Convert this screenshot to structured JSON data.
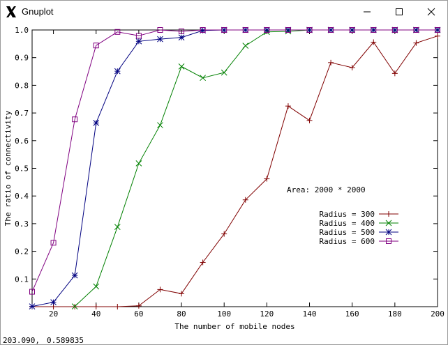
{
  "window": {
    "title": "Gnuplot",
    "app_icon": "gnuplot-x-icon",
    "controls": [
      "minimize-icon",
      "maximize-icon",
      "close-icon"
    ]
  },
  "status": {
    "x": "203.090,",
    "y": "0.589835"
  },
  "chart_data": {
    "type": "line",
    "title": "",
    "xlabel": "The number of mobile nodes",
    "ylabel": "The ratio of connectivity",
    "xlim": [
      10,
      200
    ],
    "ylim": [
      0,
      1.0
    ],
    "xticks": [
      20,
      40,
      60,
      80,
      100,
      120,
      140,
      160,
      180,
      200
    ],
    "yticks": [
      0.1,
      0.2,
      0.3,
      0.4,
      0.5,
      0.6,
      0.7,
      0.8,
      0.9,
      1.0
    ],
    "ytick_labels": [
      "0.1",
      "0.2",
      "0.3",
      "0.4",
      "0.5",
      "0.6",
      "0.7",
      "0.8",
      "0.9",
      "1.0"
    ],
    "annotation": "Area: 2000 * 2000",
    "annotation_color": "#008080",
    "grid": false,
    "legend_position": "right",
    "x": [
      10,
      20,
      30,
      40,
      50,
      60,
      70,
      80,
      90,
      100,
      110,
      120,
      130,
      140,
      150,
      160,
      170,
      180,
      190,
      200
    ],
    "series": [
      {
        "name": "Radius = 300",
        "color": "#800000",
        "marker": "plus",
        "values": [
          0,
          0,
          0,
          0,
          0,
          0.003,
          0.062,
          0.047,
          0.16,
          0.263,
          0.386,
          0.462,
          0.725,
          0.673,
          0.882,
          0.864,
          0.956,
          0.843,
          0.953,
          0.978
        ]
      },
      {
        "name": "Radius = 400",
        "color": "#008000",
        "marker": "cross",
        "values": [
          null,
          null,
          0.001,
          0.073,
          0.288,
          0.518,
          0.656,
          0.868,
          0.827,
          0.846,
          0.943,
          0.993,
          0.995,
          1.0,
          1.0,
          1.0,
          1.0,
          1.0,
          1.0,
          1.0
        ]
      },
      {
        "name": "Radius = 500",
        "color": "#000080",
        "marker": "star",
        "values": [
          0.001,
          0.016,
          0.113,
          0.664,
          0.851,
          0.959,
          0.967,
          0.973,
          0.998,
          1.0,
          1.0,
          1.0,
          1.0,
          1.0,
          1.0,
          1.0,
          1.0,
          1.0,
          1.0,
          1.0
        ]
      },
      {
        "name": "Radius = 600",
        "color": "#800080",
        "marker": "box",
        "values": [
          0.054,
          0.231,
          0.677,
          0.944,
          0.993,
          0.979,
          1.0,
          0.995,
          1.0,
          1.0,
          1.0,
          1.0,
          1.0,
          1.0,
          1.0,
          1.0,
          1.0,
          1.0,
          1.0,
          1.0
        ]
      }
    ]
  }
}
